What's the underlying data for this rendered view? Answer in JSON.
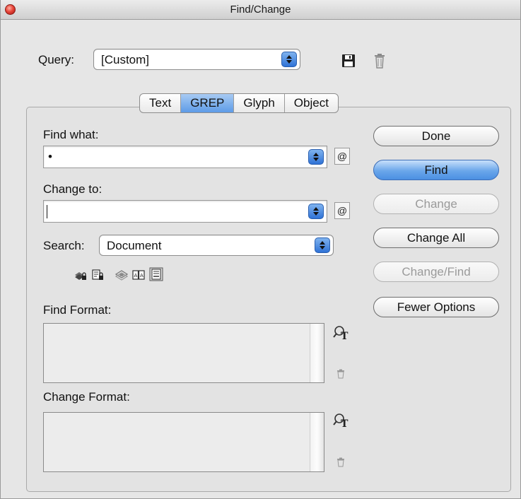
{
  "window": {
    "title": "Find/Change"
  },
  "query": {
    "label": "Query:",
    "value": "[Custom]"
  },
  "tabs": [
    {
      "label": "Text",
      "active": false
    },
    {
      "label": "GREP",
      "active": true
    },
    {
      "label": "Glyph",
      "active": false
    },
    {
      "label": "Object",
      "active": false
    }
  ],
  "find_what": {
    "label": "Find what:",
    "value": "•",
    "special_char_button": "@"
  },
  "change_to": {
    "label": "Change to:",
    "value": "",
    "special_char_button": "@"
  },
  "search": {
    "label": "Search:",
    "value": "Document"
  },
  "buttons": {
    "done": "Done",
    "find": "Find",
    "change": "Change",
    "change_all": "Change All",
    "change_find": "Change/Find",
    "fewer_options": "Fewer Options"
  },
  "find_format": {
    "label": "Find Format:"
  },
  "change_format": {
    "label": "Change Format:"
  },
  "icons": {
    "save_query": "floppy-disk-icon",
    "delete_query": "trash-icon",
    "include_locked_layers": "locked-layers-icon",
    "include_locked_stories": "locked-stories-icon",
    "include_hidden_layers": "hidden-layers-icon",
    "include_master_pages": "master-pages-icon",
    "include_footnotes": "footnotes-icon",
    "specify_format": "format-search-icon",
    "clear_format": "small-trash-icon"
  },
  "colors": {
    "accent": "#5d9be7",
    "default_button": "#6aa6ea",
    "close_button": "#e8463a"
  }
}
